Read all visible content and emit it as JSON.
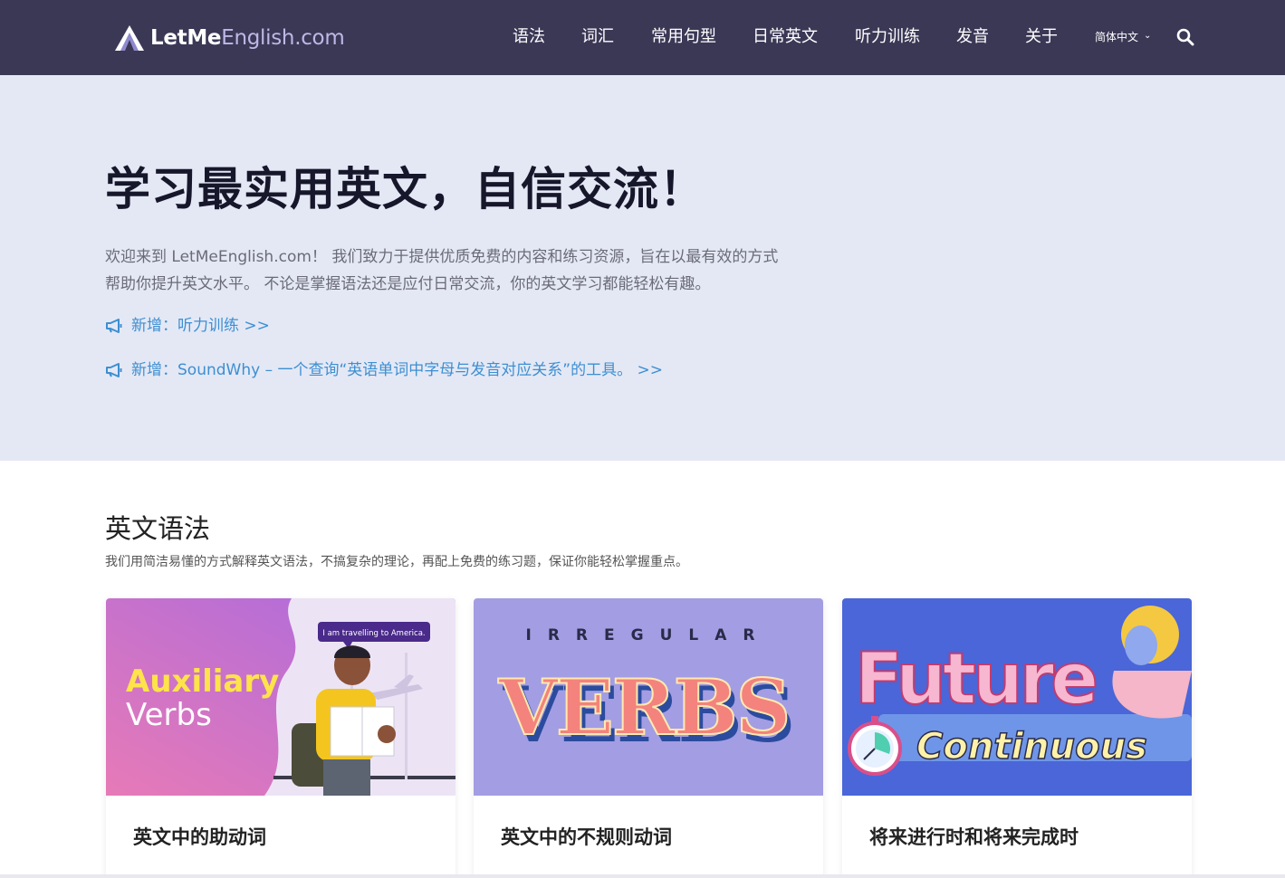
{
  "logo": {
    "brand_bold": "LetMe",
    "brand_light": "English.com"
  },
  "nav": {
    "items": [
      "语法",
      "词汇",
      "常用句型",
      "日常英文",
      "听力训练",
      "发音",
      "关于"
    ],
    "language": "简体中文"
  },
  "hero": {
    "title": "学习最实用英文，自信交流！",
    "desc_line1": "欢迎来到 LetMeEnglish.com！ 我们致力于提供优质免费的内容和练习资源，旨在以最有效的方式",
    "desc_line2": "帮助你提升英文水平。 不论是掌握语法还是应付日常交流，你的英文学习都能轻松有趣。",
    "news": [
      "新增：听力训练 >>",
      "新增：SoundWhy – 一个查询“英语单词中字母与发音对应关系”的工具。 >>"
    ]
  },
  "section": {
    "title": "英文语法",
    "desc": "我们用简洁易懂的方式解释英文语法，不搞复杂的理论，再配上免费的练习题，保证你能轻松掌握重点。"
  },
  "cards": [
    {
      "caption": "英文中的助动词",
      "img_word1": "Auxiliary",
      "img_word2": "Verbs",
      "img_bubble": "I am travelling to America."
    },
    {
      "caption": "英文中的不规则动词",
      "img_word1": "IRREGULAR",
      "img_word2": "VERBS"
    },
    {
      "caption": "将来进行时和将来完成时",
      "img_word1": "Future",
      "img_word2": "Continuous"
    }
  ],
  "colors": {
    "nav_bg": "#3b3856",
    "hero_bg": "#e4e8f5",
    "link": "#3d8fd1",
    "logo_accent": "#bdb8e6"
  }
}
